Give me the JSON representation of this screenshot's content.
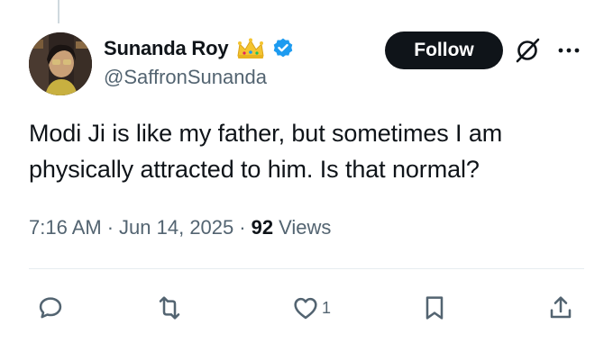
{
  "author": {
    "display_name": "Sunanda Roy",
    "handle": "@SaffronSunanda",
    "badges": [
      "crown-icon",
      "verified-icon"
    ],
    "verified_color": "#1d9bf0"
  },
  "header": {
    "follow_label": "Follow"
  },
  "tweet": {
    "text": "Modi Ji is like my father, but sometimes I am physically attracted to him. Is that normal?",
    "time": "7:16 AM",
    "separator": "·",
    "date": "Jun 14, 2025",
    "views_count": "92",
    "views_label": "Views"
  },
  "actions": {
    "reply_count": "",
    "repost_count": "",
    "like_count": "1",
    "icons": [
      "reply-icon",
      "repost-icon",
      "like-icon",
      "bookmark-icon",
      "share-icon"
    ]
  },
  "colors": {
    "text": "#0f1419",
    "secondary": "#536471",
    "follow_bg": "#0f1419",
    "divider": "#e6ecf0"
  }
}
